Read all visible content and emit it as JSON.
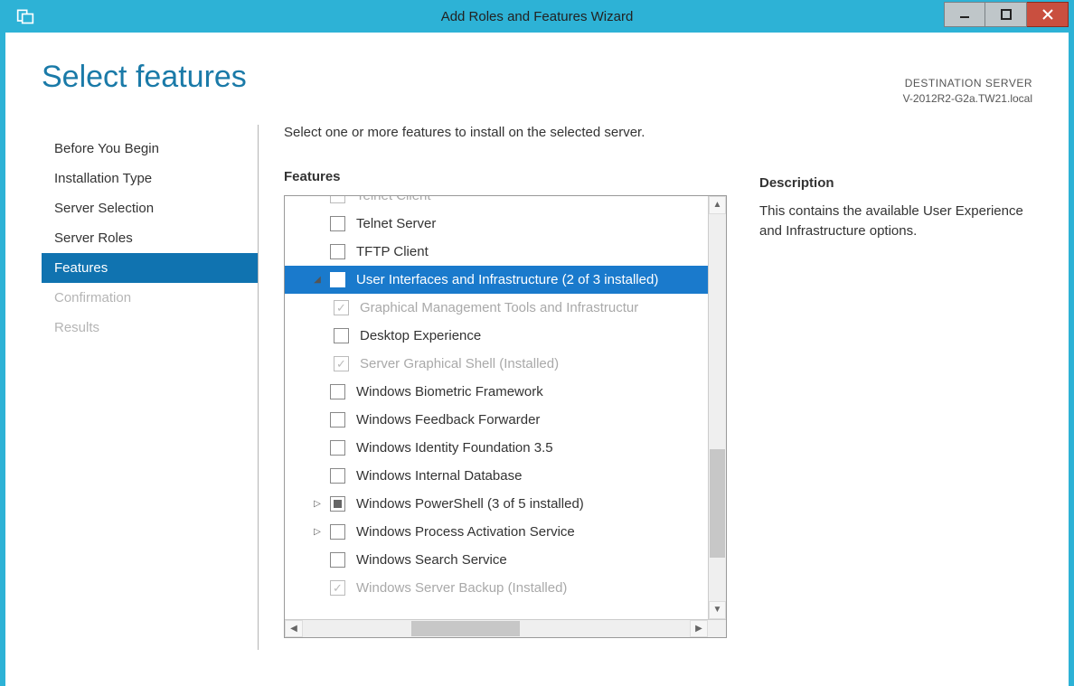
{
  "window": {
    "title": "Add Roles and Features Wizard"
  },
  "page": {
    "heading": "Select features"
  },
  "destination": {
    "label": "DESTINATION SERVER",
    "value": "V-2012R2-G2a.TW21.local"
  },
  "nav": {
    "items": [
      {
        "label": "Before You Begin",
        "state": "normal"
      },
      {
        "label": "Installation Type",
        "state": "normal"
      },
      {
        "label": "Server Selection",
        "state": "normal"
      },
      {
        "label": "Server Roles",
        "state": "normal"
      },
      {
        "label": "Features",
        "state": "active"
      },
      {
        "label": "Confirmation",
        "state": "disabled"
      },
      {
        "label": "Results",
        "state": "disabled"
      }
    ]
  },
  "main": {
    "instruction": "Select one or more features to install on the selected server.",
    "features_label": "Features",
    "description_label": "Description",
    "description_text": "This contains the available User Experience and Infrastructure options."
  },
  "tree": [
    {
      "label": "Telnet Client",
      "level": 0,
      "check": "unchecked",
      "toggle": "none",
      "sel": false,
      "grey": true,
      "cut": true
    },
    {
      "label": "Telnet Server",
      "level": 0,
      "check": "unchecked",
      "toggle": "none",
      "sel": false,
      "grey": false
    },
    {
      "label": "TFTP Client",
      "level": 0,
      "check": "unchecked",
      "toggle": "none",
      "sel": false,
      "grey": false
    },
    {
      "label": "User Interfaces and Infrastructure (2 of 3 installed)",
      "level": 0,
      "check": "mixed",
      "toggle": "open",
      "sel": true,
      "grey": false
    },
    {
      "label": "Graphical Management Tools and Infrastructur",
      "level": 1,
      "check": "checked",
      "toggle": "none",
      "sel": false,
      "grey": true
    },
    {
      "label": "Desktop Experience",
      "level": 1,
      "check": "unchecked",
      "toggle": "none",
      "sel": false,
      "grey": false
    },
    {
      "label": "Server Graphical Shell (Installed)",
      "level": 1,
      "check": "checked",
      "toggle": "none",
      "sel": false,
      "grey": true
    },
    {
      "label": "Windows Biometric Framework",
      "level": 0,
      "check": "unchecked",
      "toggle": "none",
      "sel": false,
      "grey": false
    },
    {
      "label": "Windows Feedback Forwarder",
      "level": 0,
      "check": "unchecked",
      "toggle": "none",
      "sel": false,
      "grey": false
    },
    {
      "label": "Windows Identity Foundation 3.5",
      "level": 0,
      "check": "unchecked",
      "toggle": "none",
      "sel": false,
      "grey": false
    },
    {
      "label": "Windows Internal Database",
      "level": 0,
      "check": "unchecked",
      "toggle": "none",
      "sel": false,
      "grey": false
    },
    {
      "label": "Windows PowerShell (3 of 5 installed)",
      "level": 0,
      "check": "mixed",
      "toggle": "closed",
      "sel": false,
      "grey": false
    },
    {
      "label": "Windows Process Activation Service",
      "level": 0,
      "check": "unchecked",
      "toggle": "closed",
      "sel": false,
      "grey": false
    },
    {
      "label": "Windows Search Service",
      "level": 0,
      "check": "unchecked",
      "toggle": "none",
      "sel": false,
      "grey": false
    },
    {
      "label": "Windows Server Backup (Installed)",
      "level": 0,
      "check": "checked",
      "toggle": "none",
      "sel": false,
      "grey": true
    }
  ]
}
